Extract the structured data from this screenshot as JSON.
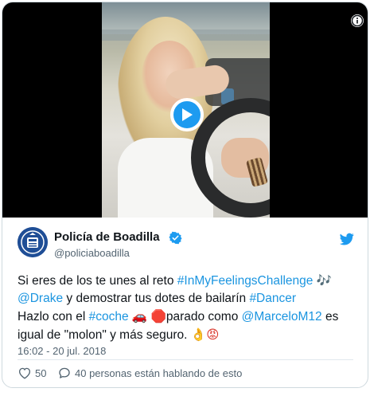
{
  "account": {
    "display_name": "Policía de Boadilla",
    "handle": "@policiaboadilla"
  },
  "tweet": {
    "line1_a": "Si eres de los te unes al reto ",
    "hashtag_challenge": "#InMyFeelingsChallenge",
    "emoji_music": "🎶",
    "mention_drake": "@Drake",
    "line2_b": " y demostrar tus dotes de bailarín ",
    "hashtag_dancer": "#Dancer",
    "line3_a": "Hazlo con el ",
    "hashtag_coche": "#coche",
    "emoji_car": "🚗",
    "emoji_stop": "🛑",
    "line3_b": "parado como ",
    "mention_marcelo": "@MarceloM12",
    "line3_c": " es igual de \"molon\" y más seguro. ",
    "emoji_ok": "👌",
    "emoji_angry": "😡"
  },
  "timestamp": "16:02 - 20 jul. 2018",
  "actions": {
    "like_count": "50",
    "conversation": "40 personas están hablando de esto"
  },
  "icons": {
    "play": "play-icon",
    "info": "info-icon",
    "verified": "verified-badge-icon",
    "twitter": "twitter-bird-icon",
    "like": "heart-icon",
    "reply": "reply-bubble-icon"
  },
  "colors": {
    "accent": "#1d9bf0",
    "link": "#1b95e0",
    "text": "#0f1419",
    "secondary": "#536471"
  }
}
